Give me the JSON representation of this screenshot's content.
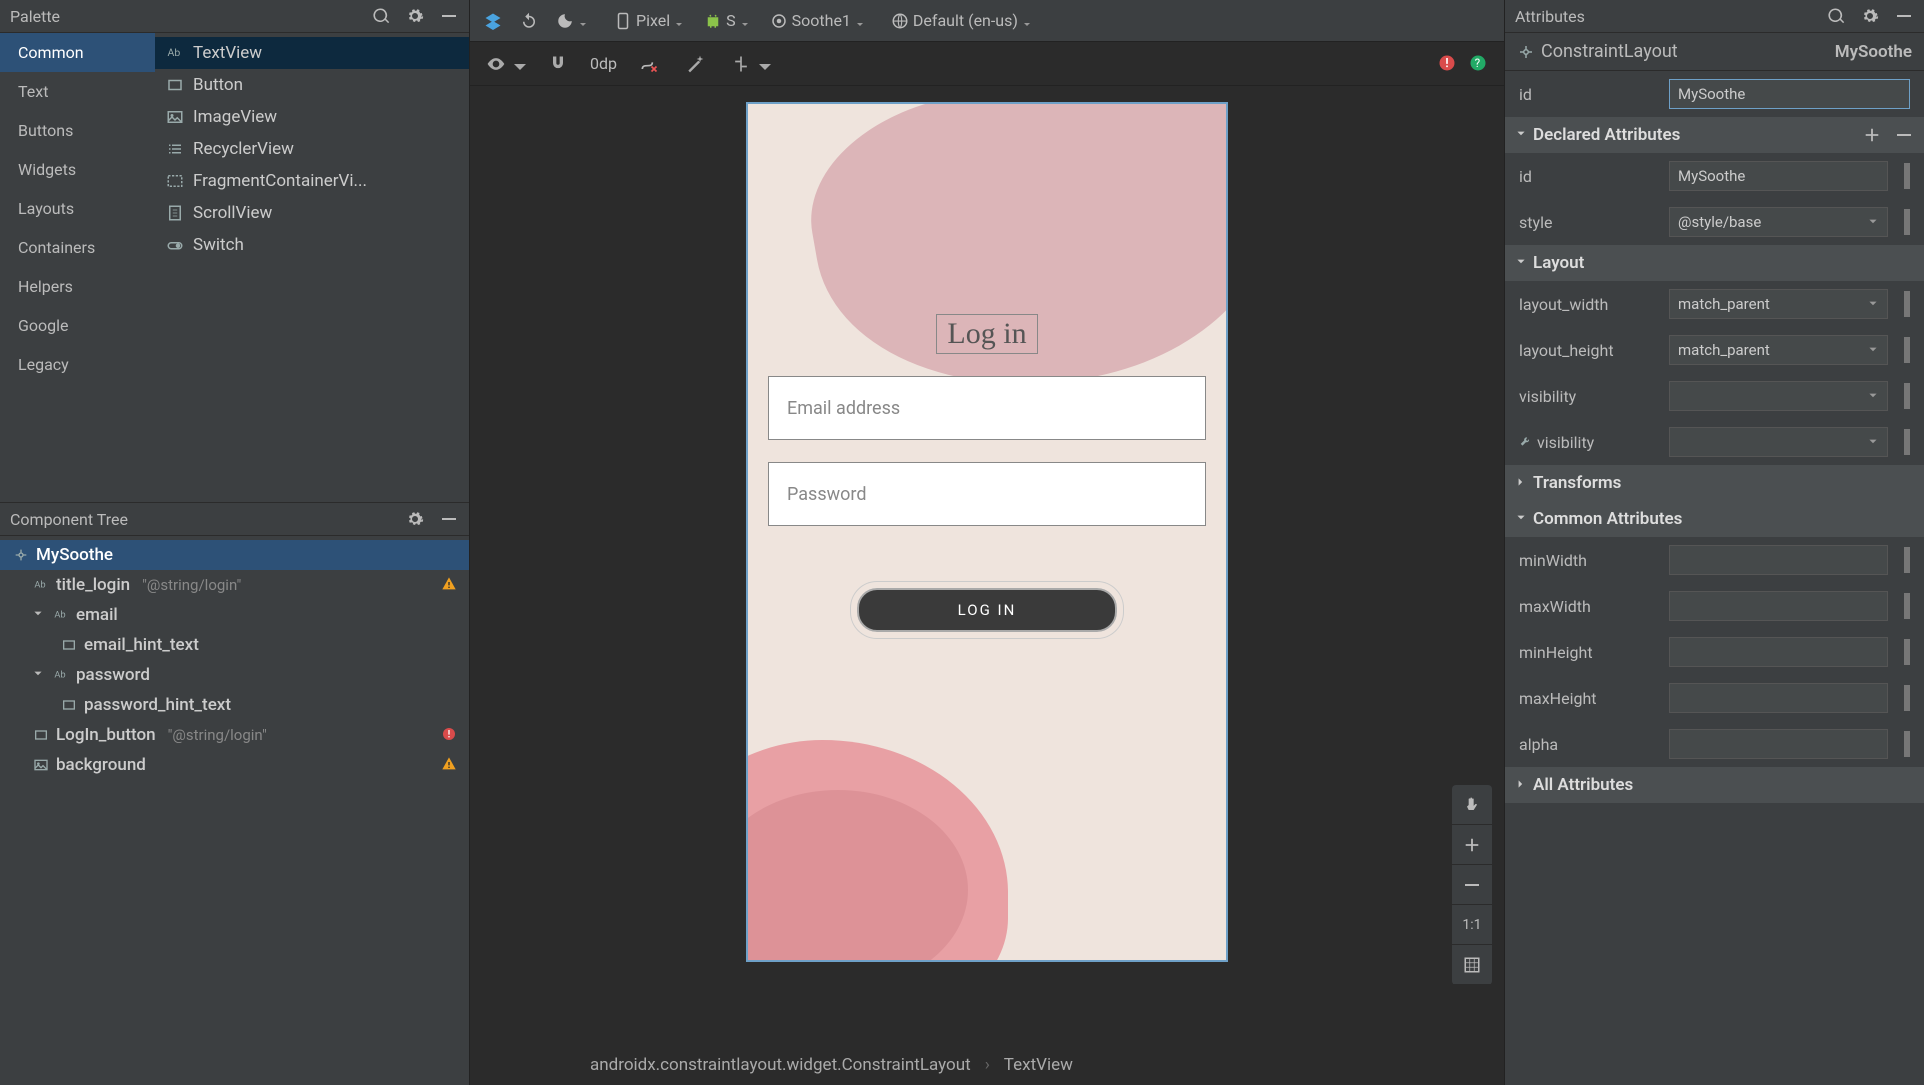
{
  "palette": {
    "title": "Palette",
    "categories": [
      "Common",
      "Text",
      "Buttons",
      "Widgets",
      "Layouts",
      "Containers",
      "Helpers",
      "Google",
      "Legacy"
    ],
    "selected_category": "Common",
    "items": [
      {
        "icon": "text",
        "label": "TextView"
      },
      {
        "icon": "button",
        "label": "Button"
      },
      {
        "icon": "image",
        "label": "ImageView"
      },
      {
        "icon": "list",
        "label": "RecyclerView"
      },
      {
        "icon": "fragment",
        "label": "FragmentContainerVi..."
      },
      {
        "icon": "scroll",
        "label": "ScrollView"
      },
      {
        "icon": "switch",
        "label": "Switch"
      }
    ]
  },
  "component_tree": {
    "title": "Component Tree",
    "nodes": [
      {
        "icon": "constraint",
        "label": "MySoothe",
        "selected": true
      },
      {
        "icon": "text",
        "label": "title_login",
        "value": "\"@string/login\"",
        "indent": 1,
        "warn": "warn"
      },
      {
        "icon": "text",
        "label": "email",
        "indent": 1,
        "expand": true
      },
      {
        "icon": "box",
        "label": "email_hint_text",
        "indent": 2
      },
      {
        "icon": "text",
        "label": "password",
        "indent": 1,
        "expand": true
      },
      {
        "icon": "box",
        "label": "password_hint_text",
        "indent": 2
      },
      {
        "icon": "button",
        "label": "LogIn_button",
        "value": "\"@string/login\"",
        "indent": 1,
        "warn": "error"
      },
      {
        "icon": "image",
        "label": "background",
        "indent": 1,
        "warn": "warn"
      }
    ]
  },
  "top_toolbar": {
    "device": "Pixel",
    "api": "S",
    "theme": "Soothe1",
    "locale": "Default (en-us)"
  },
  "sub_toolbar": {
    "dp": "0dp"
  },
  "device_preview": {
    "title": "Log in",
    "email_hint": "Email address",
    "password_hint": "Password",
    "login_btn": "LOG IN"
  },
  "zoom": {
    "ratio": "1:1"
  },
  "breadcrumb": {
    "root": "androidx.constraintlayout.widget.ConstraintLayout",
    "child": "TextView"
  },
  "attributes": {
    "title": "Attributes",
    "root_type": "ConstraintLayout",
    "root_name": "MySoothe",
    "id_label": "id",
    "id_value": "MySoothe",
    "sections": {
      "declared": "Declared Attributes",
      "layout": "Layout",
      "transforms": "Transforms",
      "common": "Common Attributes",
      "all": "All Attributes"
    },
    "declared": [
      {
        "label": "id",
        "value": "MySoothe"
      },
      {
        "label": "style",
        "value": "@style/base",
        "select": true
      }
    ],
    "layout": [
      {
        "label": "layout_width",
        "value": "match_parent",
        "select": true
      },
      {
        "label": "layout_height",
        "value": "match_parent",
        "select": true
      },
      {
        "label": "visibility",
        "value": "",
        "select": true
      },
      {
        "label": "visibility",
        "value": "",
        "select": true,
        "tool": true
      }
    ],
    "common": [
      {
        "label": "minWidth",
        "value": ""
      },
      {
        "label": "maxWidth",
        "value": ""
      },
      {
        "label": "minHeight",
        "value": ""
      },
      {
        "label": "maxHeight",
        "value": ""
      },
      {
        "label": "alpha",
        "value": ""
      }
    ]
  }
}
